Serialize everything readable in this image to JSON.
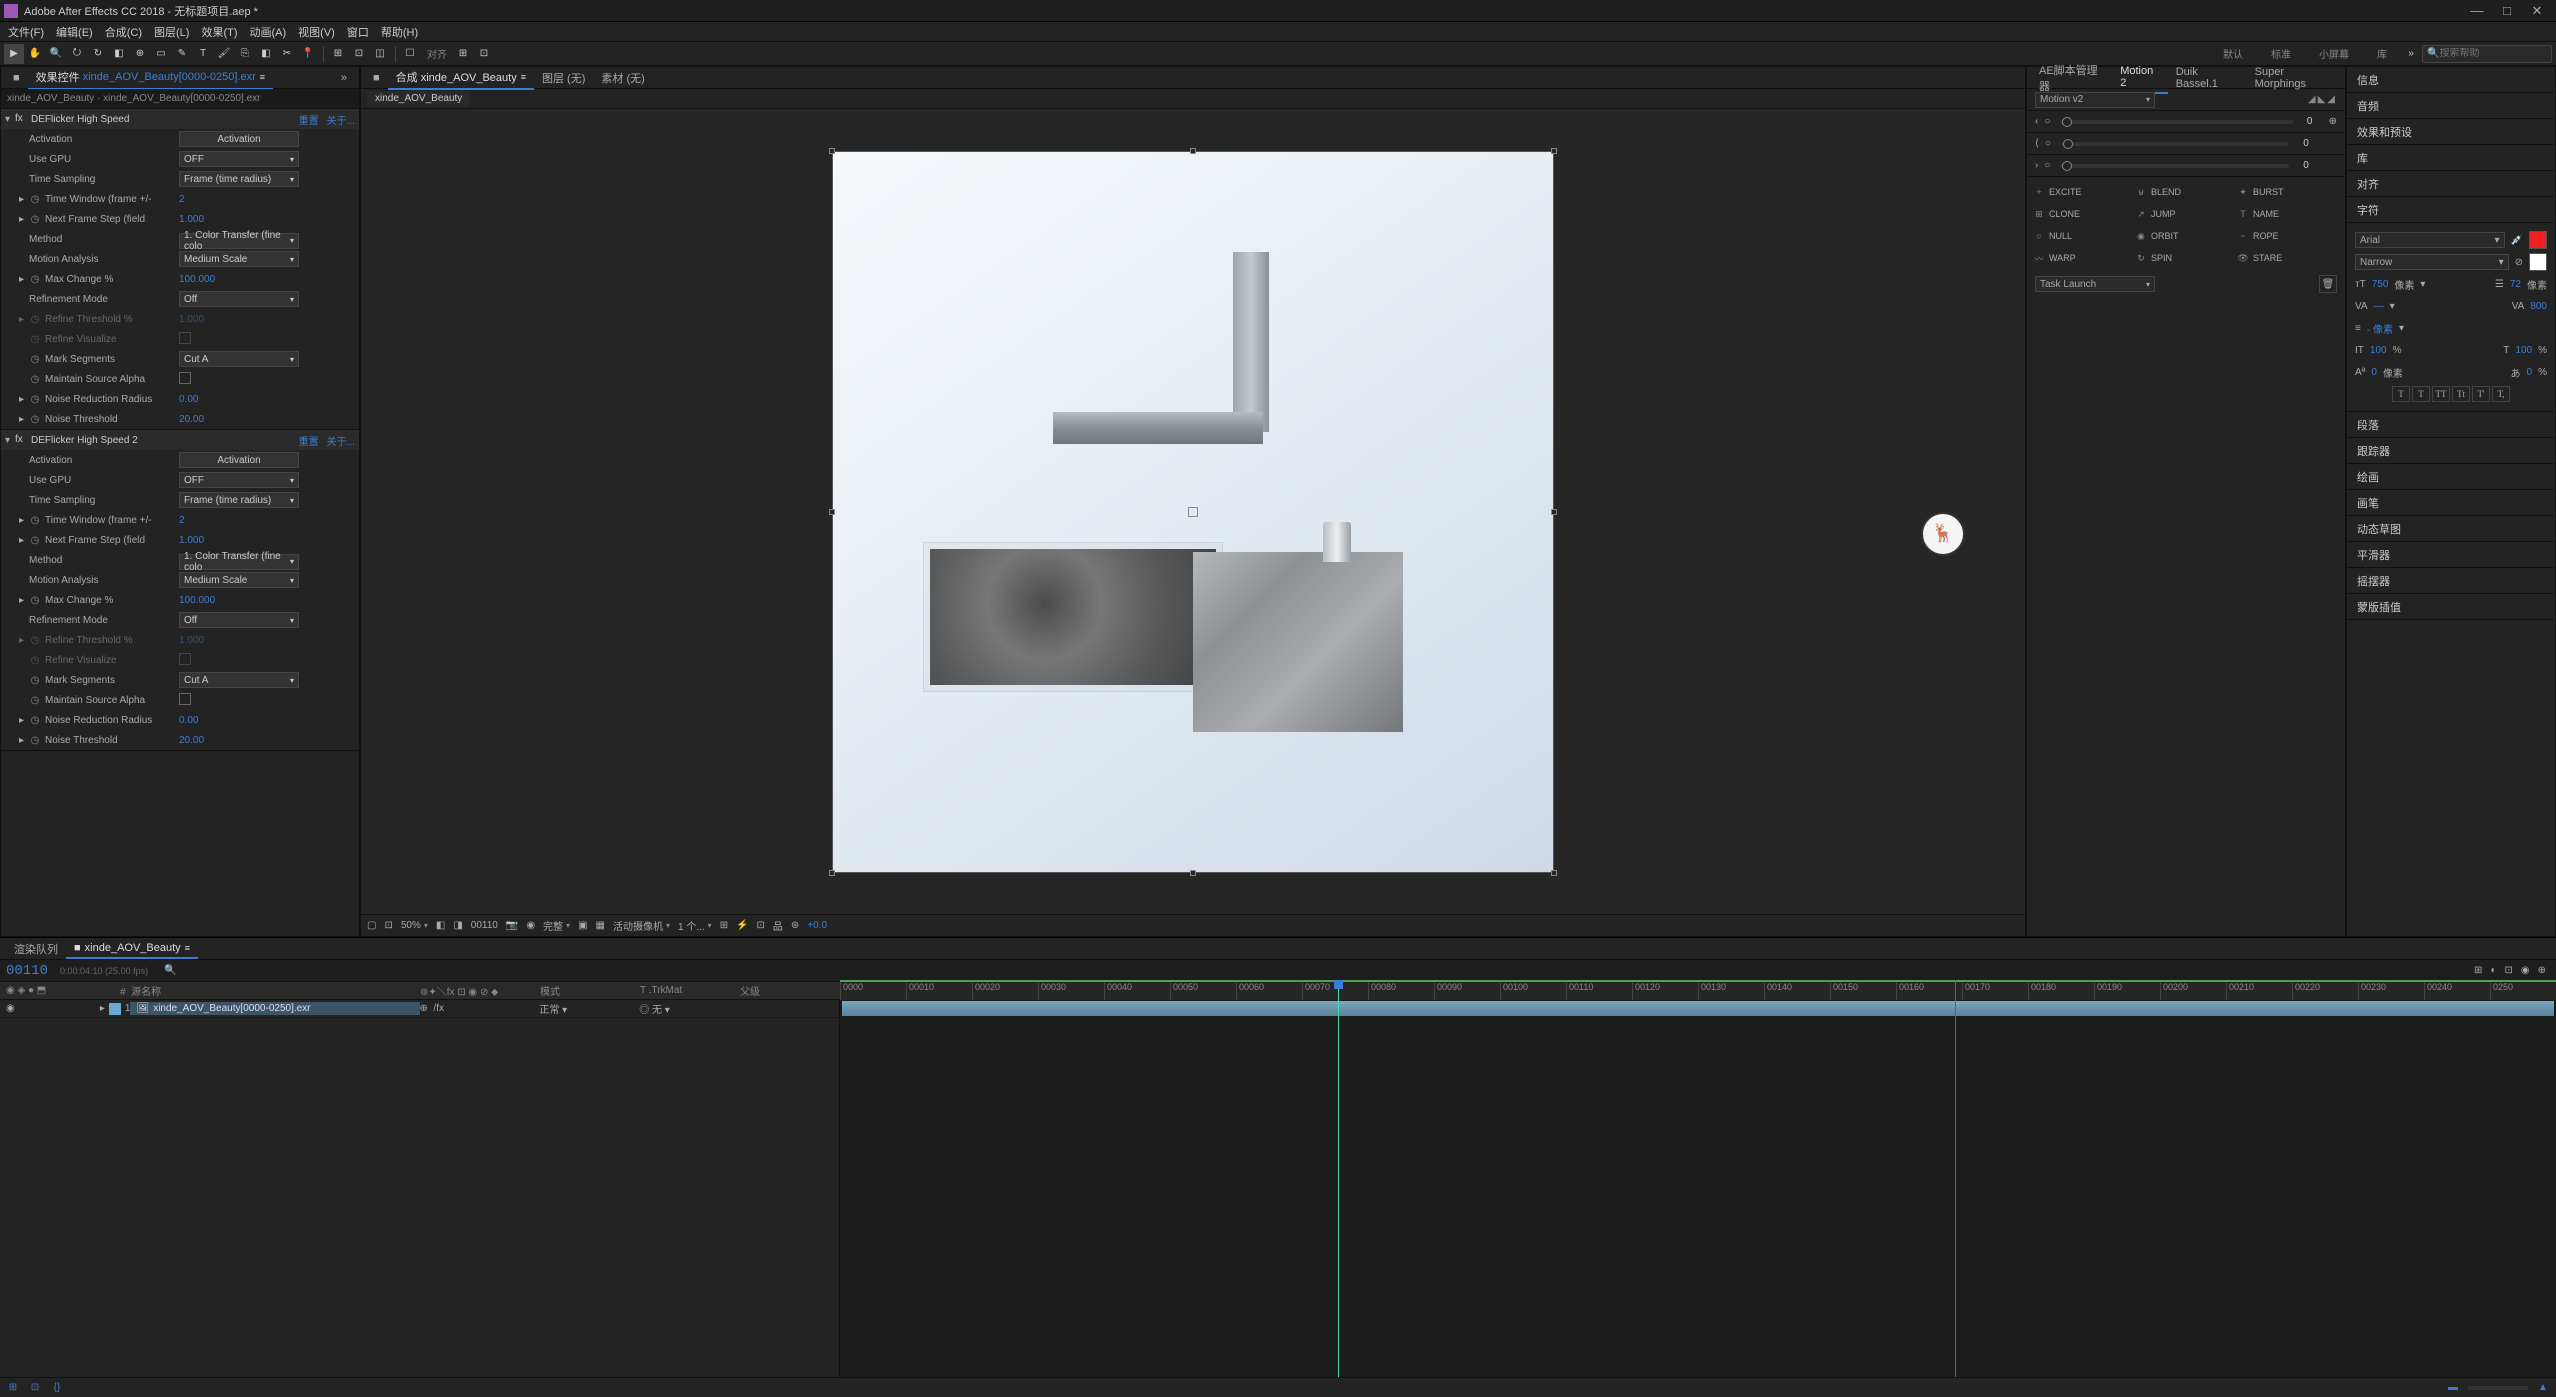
{
  "title": "Adobe After Effects CC 2018 - 无标题项目.aep *",
  "menu": [
    "文件(F)",
    "编辑(E)",
    "合成(C)",
    "图层(L)",
    "效果(T)",
    "动画(A)",
    "视图(V)",
    "窗口",
    "帮助(H)"
  ],
  "toolbar": {
    "snap": "对齐"
  },
  "workspaces": [
    "默认",
    "标准",
    "小屏幕",
    "库"
  ],
  "search_placeholder": "搜索帮助",
  "effects_panel": {
    "tab": "效果控件",
    "tab_file": "xinde_AOV_Beauty[0000-0250].exr",
    "path": "xinde_AOV_Beauty · xinde_AOV_Beauty[0000-0250].exr",
    "reset": "重置",
    "about": "关于...",
    "fx": [
      {
        "name": "DEFlicker High Speed",
        "rows": [
          {
            "label": "Activation",
            "type": "btn",
            "val": "Activation"
          },
          {
            "label": "Use GPU",
            "type": "dd",
            "val": "OFF"
          },
          {
            "label": "Time Sampling",
            "type": "dd",
            "val": "Frame (time radius)"
          },
          {
            "label": "Time Window (frame +/-",
            "type": "num",
            "val": "2",
            "arrow": true,
            "stopwatch": true
          },
          {
            "label": "Next Frame Step (field",
            "type": "num",
            "val": "1.000",
            "arrow": true,
            "stopwatch": true
          },
          {
            "label": "Method",
            "type": "dd",
            "val": "1. Color Transfer (fine colo"
          },
          {
            "label": "Motion Analysis",
            "type": "dd",
            "val": "Medium Scale"
          },
          {
            "label": "Max Change %",
            "type": "num",
            "val": "100.000",
            "arrow": true,
            "stopwatch": true
          },
          {
            "label": "Refinement Mode",
            "type": "dd",
            "val": "Off"
          },
          {
            "label": "Refine Threshold %",
            "type": "num",
            "val": "1.000",
            "arrow": true,
            "stopwatch": true,
            "dim": true
          },
          {
            "label": "Refine Visualize",
            "type": "cb",
            "val": "",
            "stopwatch": true,
            "dim": true
          },
          {
            "label": "Mark Segments",
            "type": "dd",
            "val": "Cut A",
            "stopwatch": true
          },
          {
            "label": "Maintain Source Alpha",
            "type": "cb",
            "val": "",
            "stopwatch": true
          },
          {
            "label": "Noise Reduction Radius",
            "type": "num",
            "val": "0.00",
            "arrow": true,
            "stopwatch": true
          },
          {
            "label": "Noise Threshold",
            "type": "num",
            "val": "20.00",
            "arrow": true,
            "stopwatch": true
          }
        ]
      },
      {
        "name": "DEFlicker High Speed 2",
        "rows": [
          {
            "label": "Activation",
            "type": "btn",
            "val": "Activation"
          },
          {
            "label": "Use GPU",
            "type": "dd",
            "val": "OFF"
          },
          {
            "label": "Time Sampling",
            "type": "dd",
            "val": "Frame (time radius)"
          },
          {
            "label": "Time Window (frame +/-",
            "type": "num",
            "val": "2",
            "arrow": true,
            "stopwatch": true
          },
          {
            "label": "Next Frame Step (field",
            "type": "num",
            "val": "1.000",
            "arrow": true,
            "stopwatch": true
          },
          {
            "label": "Method",
            "type": "dd",
            "val": "1. Color Transfer (fine colo"
          },
          {
            "label": "Motion Analysis",
            "type": "dd",
            "val": "Medium Scale"
          },
          {
            "label": "Max Change %",
            "type": "num",
            "val": "100.000",
            "arrow": true,
            "stopwatch": true
          },
          {
            "label": "Refinement Mode",
            "type": "dd",
            "val": "Off"
          },
          {
            "label": "Refine Threshold %",
            "type": "num",
            "val": "1.000",
            "arrow": true,
            "stopwatch": true,
            "dim": true
          },
          {
            "label": "Refine Visualize",
            "type": "cb",
            "val": "",
            "stopwatch": true,
            "dim": true
          },
          {
            "label": "Mark Segments",
            "type": "dd",
            "val": "Cut A",
            "stopwatch": true
          },
          {
            "label": "Maintain Source Alpha",
            "type": "cb",
            "val": "",
            "stopwatch": true
          },
          {
            "label": "Noise Reduction Radius",
            "type": "num",
            "val": "0.00",
            "arrow": true,
            "stopwatch": true
          },
          {
            "label": "Noise Threshold",
            "type": "num",
            "val": "20.00",
            "arrow": true,
            "stopwatch": true
          }
        ]
      }
    ]
  },
  "comp_panel": {
    "tabs": [
      "合成 xinde_AOV_Beauty",
      "图层 (无)",
      "素材 (无)"
    ],
    "subtab": "xinde_AOV_Beauty",
    "footer": {
      "zoom": "50%",
      "frame": "00110",
      "res": "完整",
      "camera": "活动摄像机",
      "view": "1 个...",
      "plus": "+0.0"
    }
  },
  "script_panel": {
    "tab": "AE脚本管理器",
    "tabs2": [
      "Motion 2",
      "Duik Bassel.1",
      "Super Morphings"
    ],
    "preset": "Motion v2",
    "slider_vals": [
      "0",
      "0",
      "0"
    ],
    "buttons": [
      "EXCITE",
      "BLEND",
      "BURST",
      "CLONE",
      "JUMP",
      "NAME",
      "NULL",
      "ORBIT",
      "ROPE",
      "WARP",
      "SPIN",
      "STARE"
    ],
    "task": "Task Launch"
  },
  "props": {
    "sections": [
      "信息",
      "音频",
      "效果和预设",
      "库",
      "对齐",
      "字符"
    ],
    "font": "Arial",
    "weight": "Narrow",
    "size": "750",
    "size_unit": "像素",
    "leading": "72",
    "kerning": "—",
    "tracking": "800",
    "stroke": "- 像素",
    "vscale": "100",
    "vscale_unit": "%",
    "hscale": "100",
    "baseline": "0",
    "baseline_unit": "像素",
    "tsume": "0",
    "tsume_unit": "%",
    "styles": [
      "T",
      "T",
      "TT",
      "Tt",
      "T'",
      "T,"
    ],
    "bottom_sections": [
      "段落",
      "跟踪器",
      "绘画",
      "画笔",
      "动态草图",
      "平滑器",
      "摇摆器",
      "蒙版插值"
    ]
  },
  "timeline": {
    "tabs": [
      "渲染队列",
      "xinde_AOV_Beauty"
    ],
    "timecode": "00110",
    "subtc": "0:00:04:10 (25.00 fps)",
    "cols": {
      "src": "源名称",
      "mode": "模式",
      "trk": "T .TrkMat",
      "parent": "父级"
    },
    "ticks": [
      "0000",
      "00010",
      "00020",
      "00030",
      "00040",
      "00050",
      "00060",
      "00070",
      "00080",
      "00090",
      "00100",
      "00110",
      "00120",
      "00130",
      "00140",
      "00150",
      "00160",
      "00170",
      "00180",
      "00190",
      "00200",
      "00210",
      "00220",
      "00230",
      "00240",
      "0250"
    ],
    "layer": {
      "num": "1",
      "name": "xinde_AOV_Beauty[0000-0250].exr",
      "mode": "正常",
      "trk": "无"
    }
  }
}
